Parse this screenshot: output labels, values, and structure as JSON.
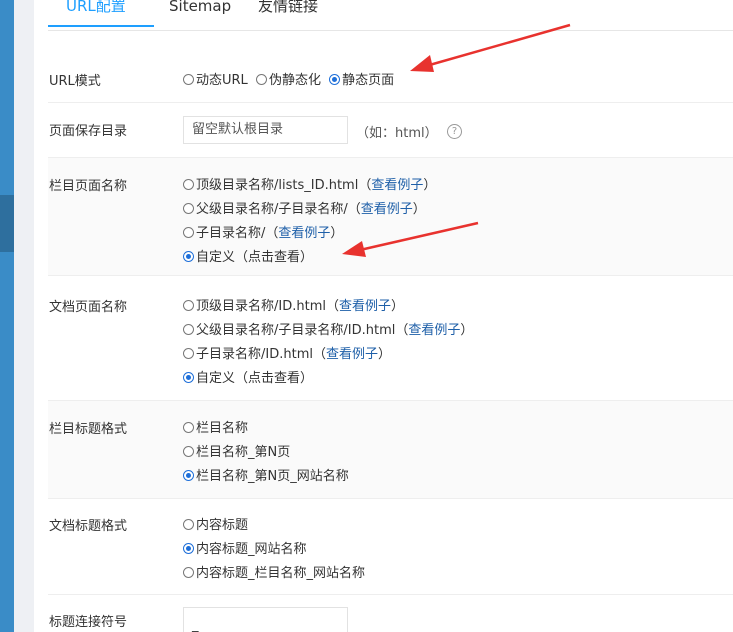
{
  "tabs": {
    "url_config": "URL配置",
    "sitemap": "Sitemap",
    "friend_links": "友情链接"
  },
  "url_mode": {
    "label": "URL模式",
    "options": [
      "动态URL",
      "伪静态化",
      "静态页面"
    ],
    "selected": "静态页面"
  },
  "save_dir": {
    "label": "页面保存目录",
    "placeholder": "留空默认根目录",
    "hint": "（如：html）",
    "help_icon": "question-icon"
  },
  "column_page_name": {
    "label": "栏目页面名称",
    "options": [
      {
        "text": "顶级目录名称/lists_ID.html（",
        "link": "查看例子",
        "tail": "）"
      },
      {
        "text": "父级目录名称/子目录名称/（",
        "link": "查看例子",
        "tail": "）"
      },
      {
        "text": "子目录名称/（",
        "link": "查看例子",
        "tail": "）"
      },
      {
        "text": "自定义（",
        "link": "点击查看",
        "tail": "）"
      }
    ],
    "selected_index": 3
  },
  "doc_page_name": {
    "label": "文档页面名称",
    "options": [
      {
        "text": "顶级目录名称/ID.html（",
        "link": "查看例子",
        "tail": "）"
      },
      {
        "text": "父级目录名称/子目录名称/ID.html（",
        "link": "查看例子",
        "tail": "）"
      },
      {
        "text": "子目录名称/ID.html（",
        "link": "查看例子",
        "tail": "）"
      },
      {
        "text": "自定义（",
        "link": "点击查看",
        "tail": "）"
      }
    ],
    "selected_index": 3
  },
  "column_title_format": {
    "label": "栏目标题格式",
    "options": [
      "栏目名称",
      "栏目名称_第N页",
      "栏目名称_第N页_网站名称"
    ],
    "selected_index": 2
  },
  "doc_title_format": {
    "label": "文档标题格式",
    "options": [
      "内容标题",
      "内容标题_网站名称",
      "内容标题_栏目名称_网站名称"
    ],
    "selected_index": 1
  },
  "title_separator": {
    "label": "标题连接符号",
    "value": "_"
  },
  "colors": {
    "accent": "#1e9fff",
    "radio_checked": "#1e6fd9",
    "link": "#1e5fa8",
    "annotation_arrow": "#e8322e",
    "sidebar": "#3a8cc7"
  }
}
